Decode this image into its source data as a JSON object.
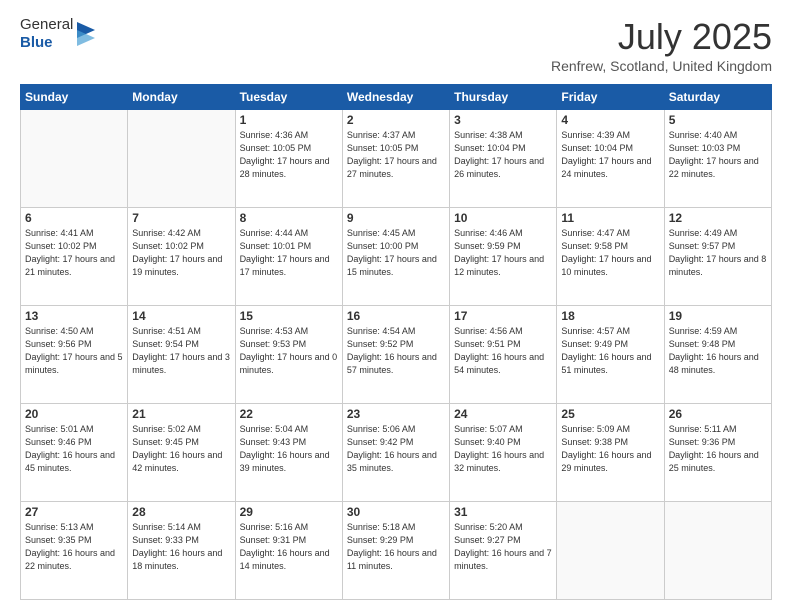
{
  "header": {
    "logo": {
      "line1": "General",
      "line2": "Blue"
    },
    "title": "July 2025",
    "location": "Renfrew, Scotland, United Kingdom"
  },
  "days_of_week": [
    "Sunday",
    "Monday",
    "Tuesday",
    "Wednesday",
    "Thursday",
    "Friday",
    "Saturday"
  ],
  "weeks": [
    [
      {
        "day": "",
        "sunrise": "",
        "sunset": "",
        "daylight": ""
      },
      {
        "day": "",
        "sunrise": "",
        "sunset": "",
        "daylight": ""
      },
      {
        "day": "1",
        "sunrise": "Sunrise: 4:36 AM",
        "sunset": "Sunset: 10:05 PM",
        "daylight": "Daylight: 17 hours and 28 minutes."
      },
      {
        "day": "2",
        "sunrise": "Sunrise: 4:37 AM",
        "sunset": "Sunset: 10:05 PM",
        "daylight": "Daylight: 17 hours and 27 minutes."
      },
      {
        "day": "3",
        "sunrise": "Sunrise: 4:38 AM",
        "sunset": "Sunset: 10:04 PM",
        "daylight": "Daylight: 17 hours and 26 minutes."
      },
      {
        "day": "4",
        "sunrise": "Sunrise: 4:39 AM",
        "sunset": "Sunset: 10:04 PM",
        "daylight": "Daylight: 17 hours and 24 minutes."
      },
      {
        "day": "5",
        "sunrise": "Sunrise: 4:40 AM",
        "sunset": "Sunset: 10:03 PM",
        "daylight": "Daylight: 17 hours and 22 minutes."
      }
    ],
    [
      {
        "day": "6",
        "sunrise": "Sunrise: 4:41 AM",
        "sunset": "Sunset: 10:02 PM",
        "daylight": "Daylight: 17 hours and 21 minutes."
      },
      {
        "day": "7",
        "sunrise": "Sunrise: 4:42 AM",
        "sunset": "Sunset: 10:02 PM",
        "daylight": "Daylight: 17 hours and 19 minutes."
      },
      {
        "day": "8",
        "sunrise": "Sunrise: 4:44 AM",
        "sunset": "Sunset: 10:01 PM",
        "daylight": "Daylight: 17 hours and 17 minutes."
      },
      {
        "day": "9",
        "sunrise": "Sunrise: 4:45 AM",
        "sunset": "Sunset: 10:00 PM",
        "daylight": "Daylight: 17 hours and 15 minutes."
      },
      {
        "day": "10",
        "sunrise": "Sunrise: 4:46 AM",
        "sunset": "Sunset: 9:59 PM",
        "daylight": "Daylight: 17 hours and 12 minutes."
      },
      {
        "day": "11",
        "sunrise": "Sunrise: 4:47 AM",
        "sunset": "Sunset: 9:58 PM",
        "daylight": "Daylight: 17 hours and 10 minutes."
      },
      {
        "day": "12",
        "sunrise": "Sunrise: 4:49 AM",
        "sunset": "Sunset: 9:57 PM",
        "daylight": "Daylight: 17 hours and 8 minutes."
      }
    ],
    [
      {
        "day": "13",
        "sunrise": "Sunrise: 4:50 AM",
        "sunset": "Sunset: 9:56 PM",
        "daylight": "Daylight: 17 hours and 5 minutes."
      },
      {
        "day": "14",
        "sunrise": "Sunrise: 4:51 AM",
        "sunset": "Sunset: 9:54 PM",
        "daylight": "Daylight: 17 hours and 3 minutes."
      },
      {
        "day": "15",
        "sunrise": "Sunrise: 4:53 AM",
        "sunset": "Sunset: 9:53 PM",
        "daylight": "Daylight: 17 hours and 0 minutes."
      },
      {
        "day": "16",
        "sunrise": "Sunrise: 4:54 AM",
        "sunset": "Sunset: 9:52 PM",
        "daylight": "Daylight: 16 hours and 57 minutes."
      },
      {
        "day": "17",
        "sunrise": "Sunrise: 4:56 AM",
        "sunset": "Sunset: 9:51 PM",
        "daylight": "Daylight: 16 hours and 54 minutes."
      },
      {
        "day": "18",
        "sunrise": "Sunrise: 4:57 AM",
        "sunset": "Sunset: 9:49 PM",
        "daylight": "Daylight: 16 hours and 51 minutes."
      },
      {
        "day": "19",
        "sunrise": "Sunrise: 4:59 AM",
        "sunset": "Sunset: 9:48 PM",
        "daylight": "Daylight: 16 hours and 48 minutes."
      }
    ],
    [
      {
        "day": "20",
        "sunrise": "Sunrise: 5:01 AM",
        "sunset": "Sunset: 9:46 PM",
        "daylight": "Daylight: 16 hours and 45 minutes."
      },
      {
        "day": "21",
        "sunrise": "Sunrise: 5:02 AM",
        "sunset": "Sunset: 9:45 PM",
        "daylight": "Daylight: 16 hours and 42 minutes."
      },
      {
        "day": "22",
        "sunrise": "Sunrise: 5:04 AM",
        "sunset": "Sunset: 9:43 PM",
        "daylight": "Daylight: 16 hours and 39 minutes."
      },
      {
        "day": "23",
        "sunrise": "Sunrise: 5:06 AM",
        "sunset": "Sunset: 9:42 PM",
        "daylight": "Daylight: 16 hours and 35 minutes."
      },
      {
        "day": "24",
        "sunrise": "Sunrise: 5:07 AM",
        "sunset": "Sunset: 9:40 PM",
        "daylight": "Daylight: 16 hours and 32 minutes."
      },
      {
        "day": "25",
        "sunrise": "Sunrise: 5:09 AM",
        "sunset": "Sunset: 9:38 PM",
        "daylight": "Daylight: 16 hours and 29 minutes."
      },
      {
        "day": "26",
        "sunrise": "Sunrise: 5:11 AM",
        "sunset": "Sunset: 9:36 PM",
        "daylight": "Daylight: 16 hours and 25 minutes."
      }
    ],
    [
      {
        "day": "27",
        "sunrise": "Sunrise: 5:13 AM",
        "sunset": "Sunset: 9:35 PM",
        "daylight": "Daylight: 16 hours and 22 minutes."
      },
      {
        "day": "28",
        "sunrise": "Sunrise: 5:14 AM",
        "sunset": "Sunset: 9:33 PM",
        "daylight": "Daylight: 16 hours and 18 minutes."
      },
      {
        "day": "29",
        "sunrise": "Sunrise: 5:16 AM",
        "sunset": "Sunset: 9:31 PM",
        "daylight": "Daylight: 16 hours and 14 minutes."
      },
      {
        "day": "30",
        "sunrise": "Sunrise: 5:18 AM",
        "sunset": "Sunset: 9:29 PM",
        "daylight": "Daylight: 16 hours and 11 minutes."
      },
      {
        "day": "31",
        "sunrise": "Sunrise: 5:20 AM",
        "sunset": "Sunset: 9:27 PM",
        "daylight": "Daylight: 16 hours and 7 minutes."
      },
      {
        "day": "",
        "sunrise": "",
        "sunset": "",
        "daylight": ""
      },
      {
        "day": "",
        "sunrise": "",
        "sunset": "",
        "daylight": ""
      }
    ]
  ]
}
